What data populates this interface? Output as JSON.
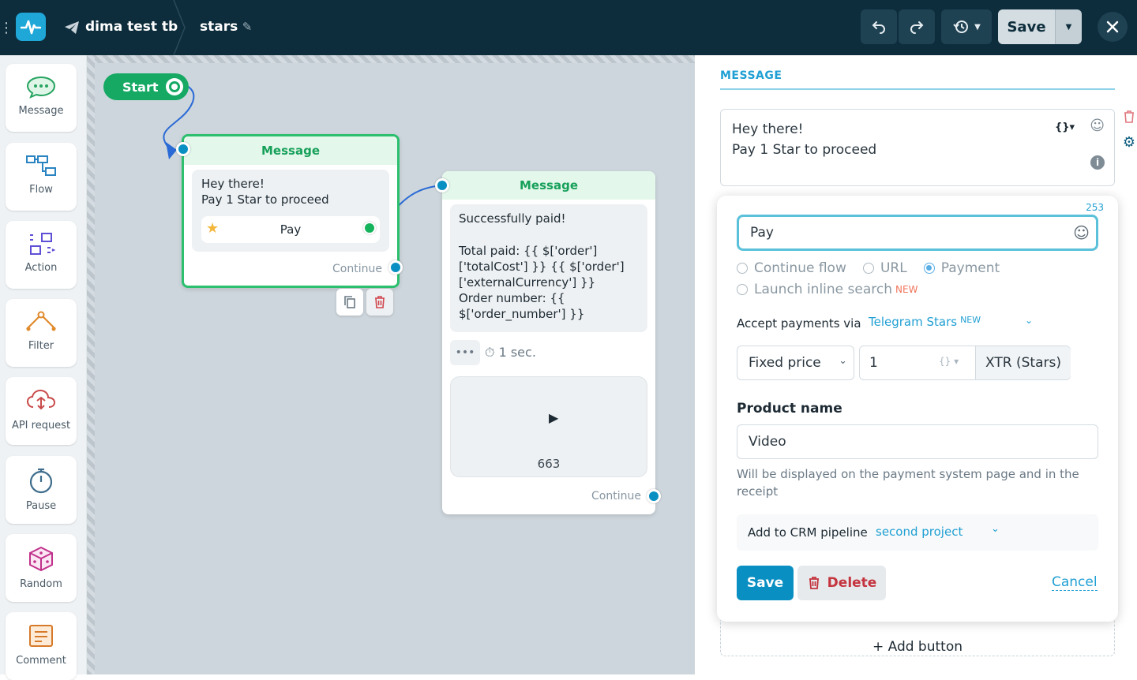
{
  "topbar": {
    "project_name": "dima test tb",
    "flow_name": "stars",
    "save_label": "Save"
  },
  "sidebar": {
    "items": [
      {
        "label": "Message",
        "icon": "chat-bubble-icon"
      },
      {
        "label": "Flow",
        "icon": "flow-icon"
      },
      {
        "label": "Action",
        "icon": "action-icon"
      },
      {
        "label": "Filter",
        "icon": "filter-icon"
      },
      {
        "label": "API request",
        "icon": "cloud-api-icon"
      },
      {
        "label": "Pause",
        "icon": "stopwatch-icon"
      },
      {
        "label": "Random",
        "icon": "dice-icon"
      },
      {
        "label": "Comment",
        "icon": "note-icon"
      }
    ]
  },
  "canvas": {
    "start_label": "Start",
    "node1": {
      "title": "Message",
      "text_line1": "Hey there!",
      "text_line2": "Pay 1 Star to proceed",
      "button_label": "Pay",
      "continue_label": "Continue"
    },
    "node2": {
      "title": "Message",
      "text_line1": "Successfully paid!",
      "text_line2": "Total paid: {{ $['order']",
      "text_line3": "['totalCost'] }} {{ $['order']",
      "text_line4": "['externalCurrency'] }}",
      "text_line5": "Order number: {{",
      "text_line6": "$['order_number'] }}",
      "delay_label": "1 sec.",
      "video_size": "663",
      "continue_label": "Continue"
    }
  },
  "panel": {
    "section_title": "MESSAGE",
    "message_line1": "Hey there!",
    "message_line2": "Pay 1 Star to proceed",
    "button_editor": {
      "char_count": "253",
      "button_text": "Pay",
      "radio_continue": "Continue flow",
      "radio_url": "URL",
      "radio_payment": "Payment",
      "radio_search": "Launch inline search",
      "new_badge": "NEW",
      "accept_label": "Accept payments via",
      "accept_value": "Telegram Stars",
      "price_type": "Fixed price",
      "price_value": "1",
      "currency": "XTR (Stars)",
      "product_label": "Product name",
      "product_value": "Video",
      "product_hint_line1": "Will be displayed on the payment system page and in the",
      "product_hint_line2": "receipt",
      "crm_label": "Add to CRM pipeline",
      "crm_value": "second project",
      "save_label": "Save",
      "delete_label": "Delete",
      "cancel_label": "Cancel"
    },
    "add_button_label": "+ Add button"
  },
  "colors": {
    "topbar": "#0d2d3c",
    "accent_green": "#17a05a",
    "accent_blue": "#0a8fc2",
    "save_primary": "#0a8fc2",
    "delete_red": "#c4343f"
  }
}
